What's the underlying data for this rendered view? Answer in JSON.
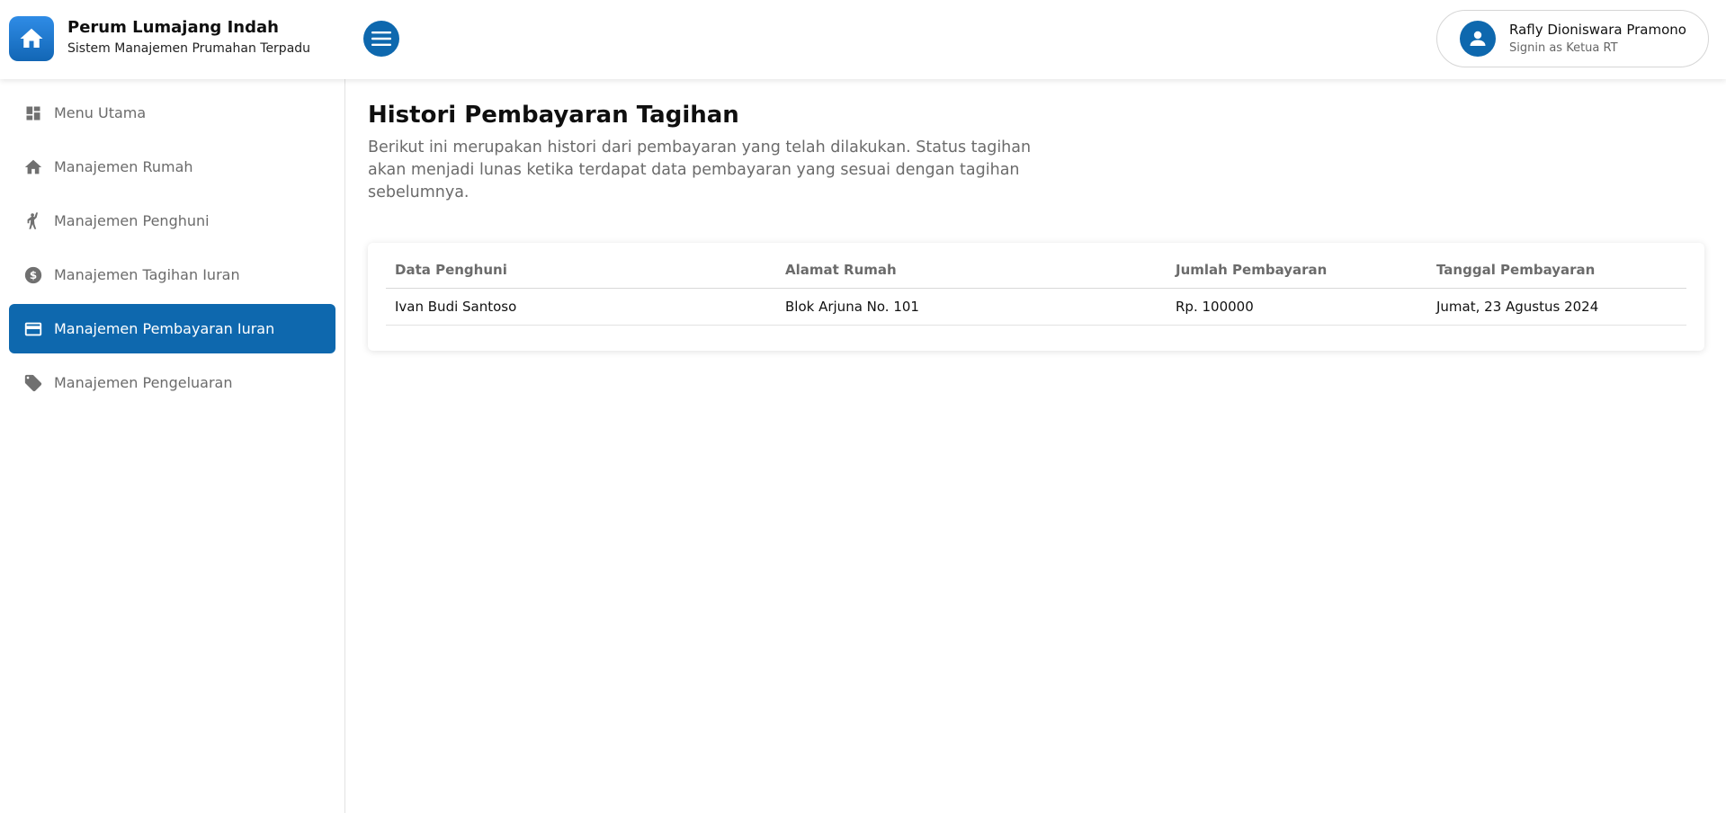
{
  "header": {
    "brand_title": "Perum Lumajang Indah",
    "brand_subtitle": "Sistem Manajemen Prumahan Terpadu",
    "user_name": "Rafly Dioniswara Pramono",
    "user_role": "Signin as Ketua RT",
    "logo_icon": "home-icon",
    "menu_icon": "hamburger-menu-icon",
    "avatar_icon": "user-icon"
  },
  "sidebar": {
    "items": [
      {
        "label": "Menu Utama",
        "icon": "dashboard-icon",
        "active": false
      },
      {
        "label": "Manajemen Rumah",
        "icon": "home-icon",
        "active": false
      },
      {
        "label": "Manajemen Penghuni",
        "icon": "person-wave-icon",
        "active": false
      },
      {
        "label": "Manajemen Tagihan Iuran",
        "icon": "dollar-circle-icon",
        "active": false
      },
      {
        "label": "Manajemen Pembayaran Iuran",
        "icon": "credit-card-icon",
        "active": true
      },
      {
        "label": "Manajemen Pengeluaran",
        "icon": "tag-icon",
        "active": false
      }
    ]
  },
  "main": {
    "title": "Histori Pembayaran Tagihan",
    "description": "Berikut ini merupakan histori dari pembayaran yang telah dilakukan. Status tagihan akan menjadi lunas ketika terdapat data pembayaran yang sesuai dengan tagihan sebelumnya.",
    "table": {
      "columns": [
        "Data Penghuni",
        "Alamat Rumah",
        "Jumlah Pembayaran",
        "Tanggal Pembayaran"
      ],
      "rows": [
        [
          "Ivan Budi Santoso",
          "Blok Arjuna No. 101",
          "Rp. 100000",
          "Jumat, 23 Agustus 2024"
        ]
      ]
    }
  },
  "colors": {
    "primary": "#0e68ae",
    "muted_text": "#6b6b6b"
  }
}
